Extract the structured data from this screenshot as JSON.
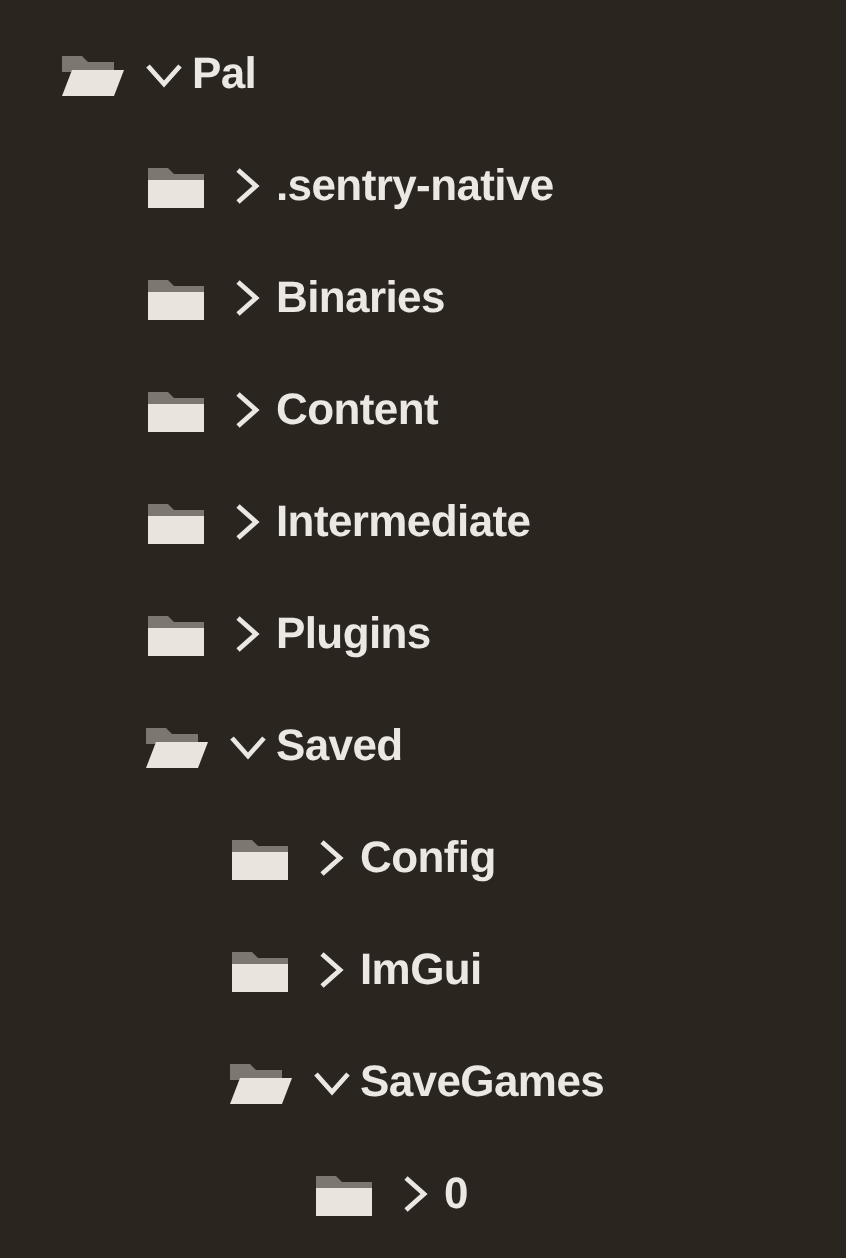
{
  "tree": [
    {
      "label": "Pal",
      "expanded": true,
      "children": [
        {
          "label": ".sentry-native",
          "expanded": false
        },
        {
          "label": "Binaries",
          "expanded": false
        },
        {
          "label": "Content",
          "expanded": false
        },
        {
          "label": "Intermediate",
          "expanded": false
        },
        {
          "label": "Plugins",
          "expanded": false
        },
        {
          "label": "Saved",
          "expanded": true,
          "children": [
            {
              "label": "Config",
              "expanded": false
            },
            {
              "label": "ImGui",
              "expanded": false
            },
            {
              "label": "SaveGames",
              "expanded": true,
              "children": [
                {
                  "label": "0",
                  "expanded": false
                }
              ]
            }
          ]
        }
      ]
    }
  ]
}
